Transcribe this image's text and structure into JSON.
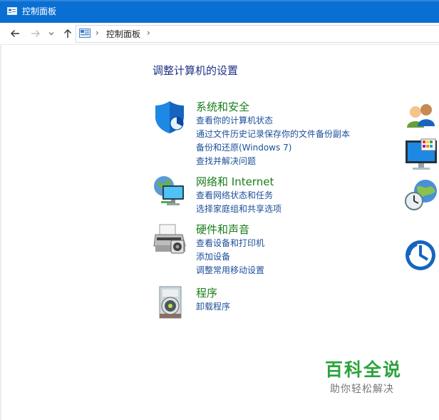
{
  "window": {
    "title": "控制面板"
  },
  "nav": {
    "back_icon": "back-arrow-icon",
    "forward_icon": "forward-arrow-icon",
    "recent_icon": "chevron-down-icon",
    "up_icon": "up-arrow-icon"
  },
  "address": {
    "breadcrumb": "控制面板",
    "separator": "›"
  },
  "main": {
    "heading": "调整计算机的设置",
    "categories": [
      {
        "title": "系统和安全",
        "icon": "shield-icon",
        "links": [
          "查看你的计算机状态",
          "通过文件历史记录保存你的文件备份副本",
          "备份和还原(Windows 7)",
          "查找并解决问题"
        ]
      },
      {
        "title": "网络和 Internet",
        "icon": "network-globe-icon",
        "links": [
          "查看网络状态和任务",
          "选择家庭组和共享选项"
        ]
      },
      {
        "title": "硬件和声音",
        "icon": "printer-icon",
        "links": [
          "查看设备和打印机",
          "添加设备",
          "调整常用移动设置"
        ]
      },
      {
        "title": "程序",
        "icon": "program-disc-icon",
        "links": [
          "卸载程序"
        ]
      }
    ]
  },
  "right_icons": [
    "user-accounts-icon",
    "appearance-display-icon",
    "clock-globe-icon",
    "ease-of-access-icon"
  ],
  "watermark": {
    "line1": "百科全说",
    "line2": "助你轻松解决"
  },
  "colors": {
    "titlebar": "#0a6fd2",
    "heading": "#1e3287",
    "category_title": "#1a7d1a",
    "link": "#1b4f9a",
    "watermark": "#2aa33a"
  }
}
